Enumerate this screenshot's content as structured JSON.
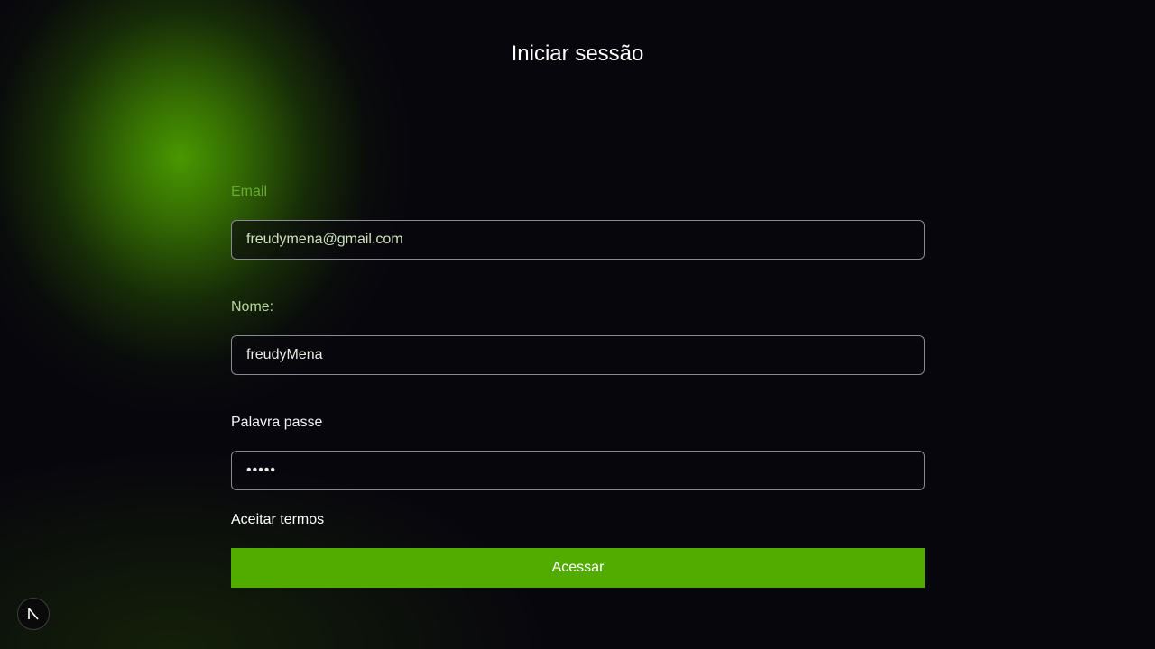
{
  "page": {
    "title": "Iniciar sessão"
  },
  "form": {
    "email": {
      "label": "Email",
      "value": "freudymena@gmail.com"
    },
    "name": {
      "label": "Nome:",
      "value": "freudyMena"
    },
    "password": {
      "label": "Palavra passe",
      "value": "•••••"
    },
    "terms_label": "Aceitar termos",
    "submit_label": "Acessar"
  },
  "colors": {
    "accent": "#52ac00",
    "background": "#08060d"
  },
  "icons": {
    "corner_badge": "next-logo-icon"
  }
}
